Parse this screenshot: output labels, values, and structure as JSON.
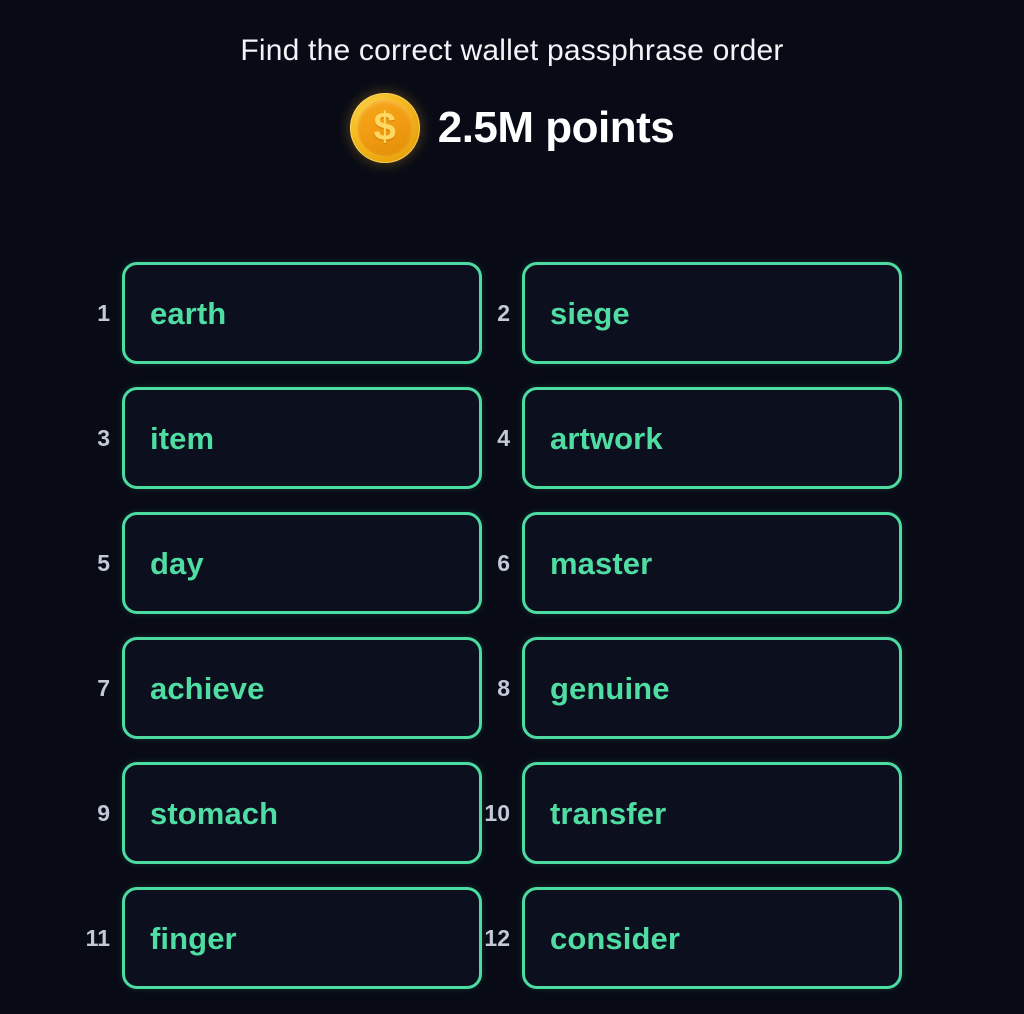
{
  "header": {
    "title": "Find the correct wallet passphrase order",
    "reward": {
      "coin_icon": "gold-coin-dollar-icon",
      "coin_symbol": "$",
      "points_label": "2.5M points"
    }
  },
  "colors": {
    "background": "#080b16",
    "tile_border": "#4cdba0",
    "tile_fill": "#0b0f1e",
    "word_text": "#4fdda3",
    "index_text": "#c3c9d6",
    "title_text": "#f2f4f8",
    "points_text": "#ffffff",
    "coin_outer": "#f5bc22",
    "coin_inner": "#f09a10",
    "coin_symbol": "#ffd862"
  },
  "passphrase_grid": {
    "columns": 2,
    "rows": 6,
    "slots": [
      {
        "index": "1",
        "word": "earth"
      },
      {
        "index": "2",
        "word": "siege"
      },
      {
        "index": "3",
        "word": "item"
      },
      {
        "index": "4",
        "word": "artwork"
      },
      {
        "index": "5",
        "word": "day"
      },
      {
        "index": "6",
        "word": "master"
      },
      {
        "index": "7",
        "word": "achieve"
      },
      {
        "index": "8",
        "word": "genuine"
      },
      {
        "index": "9",
        "word": "stomach"
      },
      {
        "index": "10",
        "word": "transfer"
      },
      {
        "index": "11",
        "word": "finger"
      },
      {
        "index": "12",
        "word": "consider"
      }
    ]
  }
}
